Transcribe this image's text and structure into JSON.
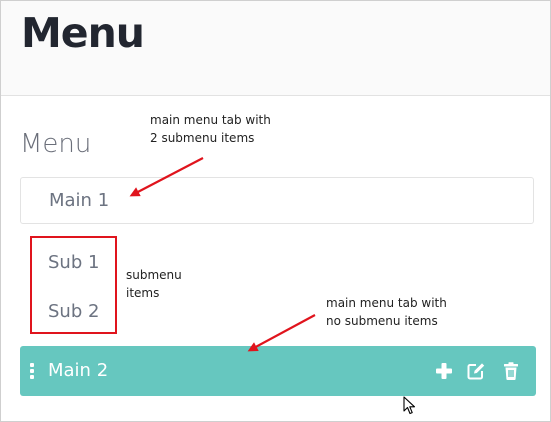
{
  "page": {
    "title": "Menu"
  },
  "menu": {
    "section_title": "Menu",
    "main_items": [
      {
        "label": "Main 1",
        "submenu": [
          "Sub 1",
          "Sub 2"
        ]
      },
      {
        "label": "Main 2",
        "submenu": [],
        "active": true
      }
    ],
    "action_icons": [
      "plus-icon",
      "edit-icon",
      "trash-icon"
    ]
  },
  "annotations": {
    "main_with_sub": {
      "line1": "main menu tab with",
      "line2": "2 submenu items"
    },
    "submenu": {
      "line1": "submenu",
      "line2": "items"
    },
    "main_no_sub": {
      "line1": "main menu tab with",
      "line2": "no submenu items"
    }
  },
  "colors": {
    "accent": "#66c7bf",
    "annotation_red": "#e0141d",
    "title": "#222630",
    "item_text": "#6c7381"
  }
}
